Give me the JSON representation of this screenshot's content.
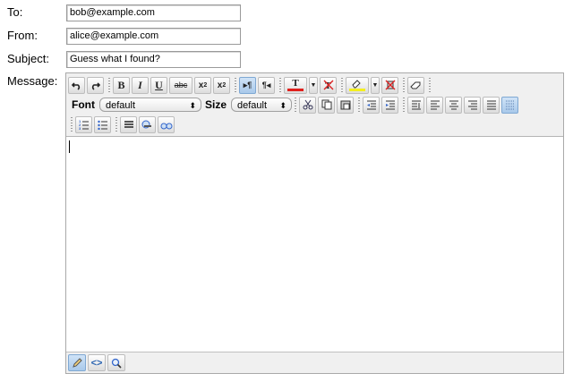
{
  "form": {
    "to_label": "To:",
    "to_value": "bob@example.com",
    "from_label": "From:",
    "from_value": "alice@example.com",
    "subject_label": "Subject:",
    "subject_value": "Guess what I found?",
    "message_label": "Message:"
  },
  "toolbar": {
    "undo": "undo-icon",
    "redo": "redo-icon",
    "bold": "B",
    "italic": "I",
    "underline": "U",
    "strikethrough": "abc",
    "subscript": "x",
    "superscript": "x",
    "ltr": "▸¶",
    "rtl": "¶◂",
    "font_color": "T",
    "highlight": "highlighter-icon",
    "eraser": "eraser-icon",
    "font_label": "Font",
    "font_value": "default",
    "size_label": "Size",
    "size_value": "default"
  },
  "colors": {
    "font_color_bar": "#e0201c",
    "highlight_bar": "#f4ef1f",
    "active_button": "#a9c9ea"
  },
  "bottom": {
    "modes": [
      "pencil-icon",
      "html-source-icon",
      "preview-icon"
    ]
  }
}
